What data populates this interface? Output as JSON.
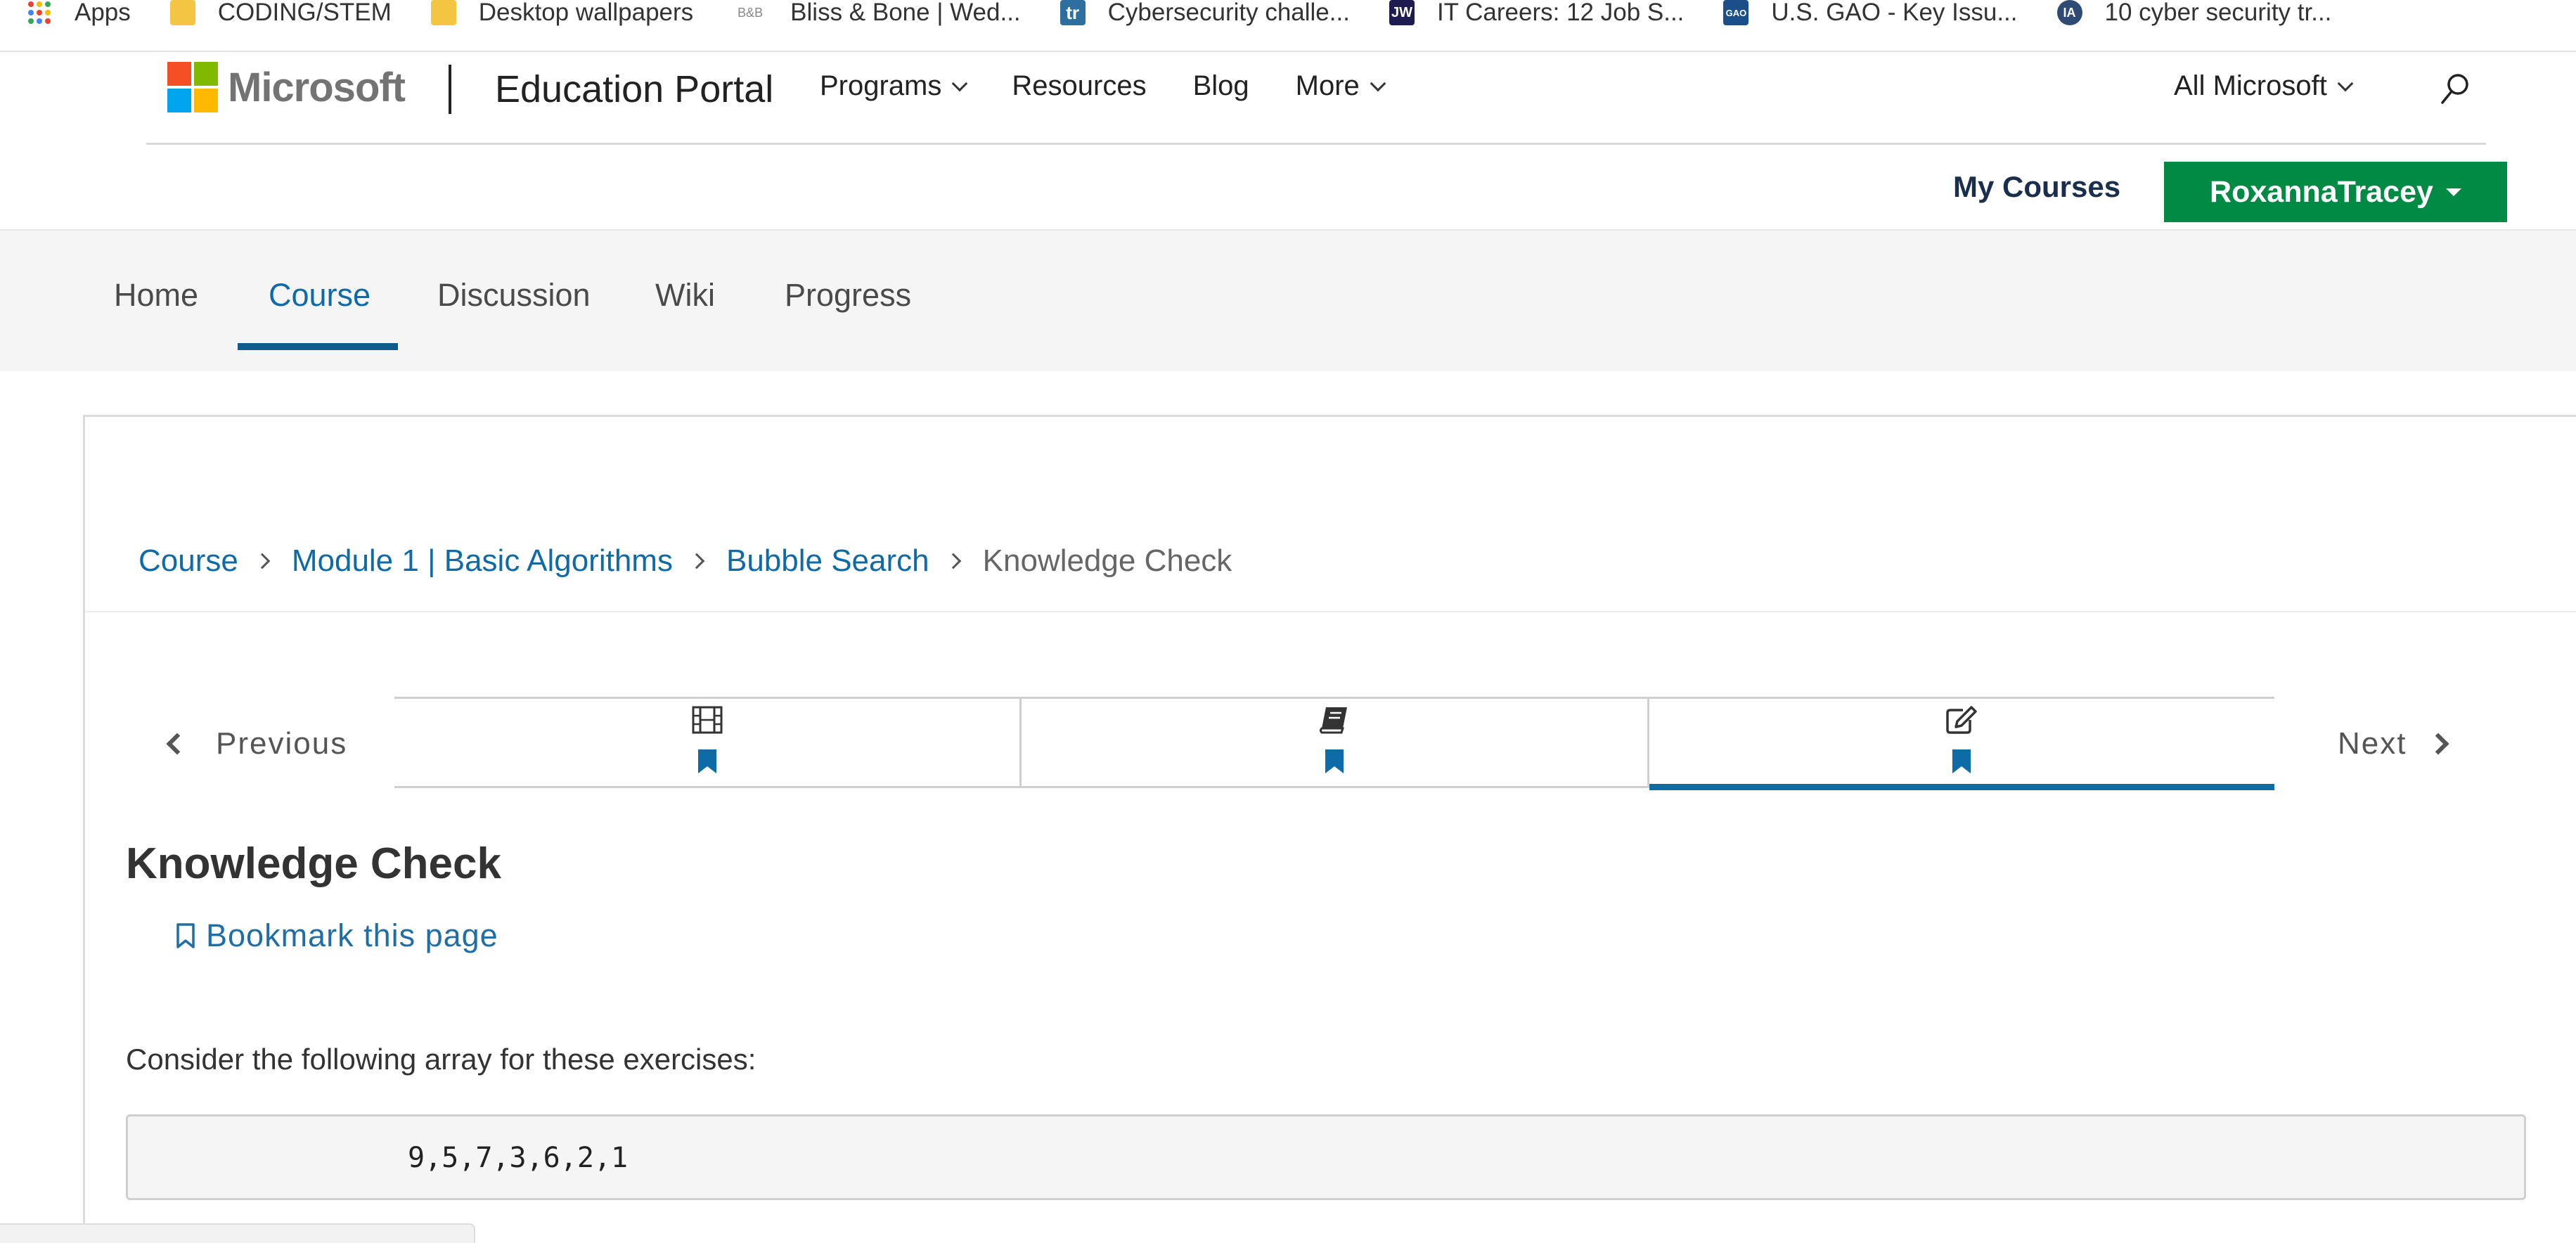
{
  "bookmarks_bar": {
    "items": [
      {
        "label": "Apps",
        "icon": "apps-grid-icon"
      },
      {
        "label": "CODING/STEM",
        "icon": "folder-icon"
      },
      {
        "label": "Desktop wallpapers",
        "icon": "folder-icon"
      },
      {
        "label": "Bliss & Bone | Wed...",
        "icon": "bliss-bone-icon",
        "icon_text": "B&B"
      },
      {
        "label": "Cybersecurity challe...",
        "icon": "tr-icon",
        "icon_text": "tr"
      },
      {
        "label": "IT Careers: 12 Job S...",
        "icon": "jw-icon",
        "icon_text": "JW"
      },
      {
        "label": "U.S. GAO - Key Issu...",
        "icon": "gao-icon",
        "icon_text": "GAO"
      },
      {
        "label": "10 cyber security tr...",
        "icon": "ia-icon",
        "icon_text": "IA"
      }
    ]
  },
  "header": {
    "logo_text": "Microsoft",
    "portal_title": "Education Portal",
    "nav": [
      "Programs",
      "Resources",
      "Blog",
      "More"
    ],
    "all_microsoft": "All Microsoft"
  },
  "user_bar": {
    "my_courses": "My Courses",
    "username": "RoxannaTracey"
  },
  "course_tabs": {
    "items": [
      "Home",
      "Course",
      "Discussion",
      "Wiki",
      "Progress"
    ],
    "active": "Course"
  },
  "breadcrumb": {
    "items": [
      "Course",
      "Module 1 | Basic Algorithms",
      "Bubble Search"
    ],
    "current": "Knowledge Check"
  },
  "sequence_nav": {
    "previous_label": "Previous",
    "next_label": "Next",
    "units": [
      {
        "icon": "video-icon",
        "bookmarked": true
      },
      {
        "icon": "book-icon",
        "bookmarked": true
      },
      {
        "icon": "edit-icon",
        "bookmarked": true,
        "active": true
      }
    ]
  },
  "unit": {
    "title": "Knowledge Check",
    "bookmark_label": "Bookmark this page",
    "intro": "Consider the following array for these exercises:",
    "code": "9,5,7,3,6,2,1"
  },
  "colors": {
    "link_blue": "#0e6ba8",
    "user_button_green": "#008a44",
    "tab_bar_bg": "#f5f5f5"
  }
}
